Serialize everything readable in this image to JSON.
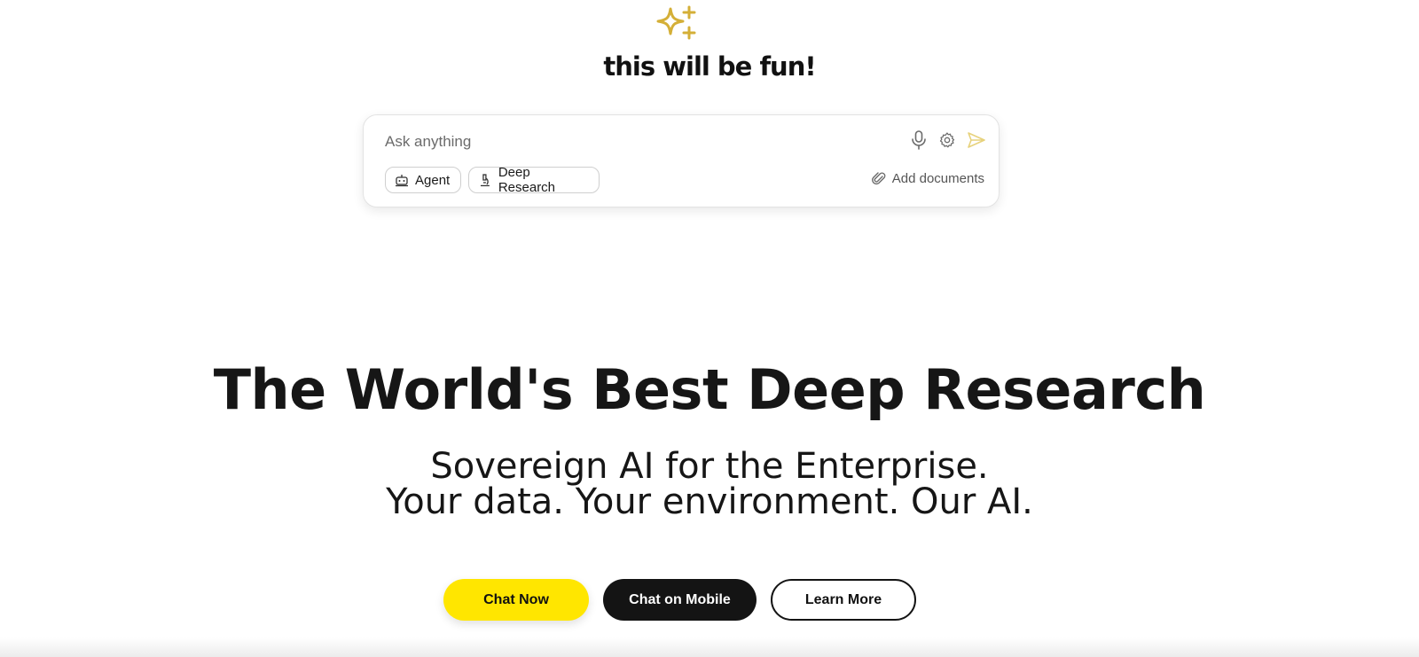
{
  "brand": {
    "tagline": "this will be fun!",
    "sparkle_icon": "sparkle-icon",
    "accent_color": "#D4AF37"
  },
  "chatbox": {
    "placeholder": "Ask anything",
    "value": "",
    "icons": {
      "mic": "microphone-icon",
      "settings": "gear-icon",
      "send": "send-icon"
    },
    "chips": [
      {
        "label": "Agent",
        "icon": "robot-icon"
      },
      {
        "label": "Deep Research",
        "icon": "microscope-icon"
      }
    ],
    "add_documents_label": "Add documents",
    "add_documents_icon": "paperclip-icon"
  },
  "hero": {
    "headline": "The World's Best Deep Research",
    "subline_1": "Sovereign AI for the Enterprise.",
    "subline_2": "Your data. Your environment. Our AI."
  },
  "cta": {
    "chat_now": "Chat Now",
    "chat_on_mobile": "Chat on Mobile",
    "learn_more": "Learn More",
    "colors": {
      "primary": "#FFE600",
      "dark": "#141414",
      "outline": "#FFFFFF"
    }
  }
}
